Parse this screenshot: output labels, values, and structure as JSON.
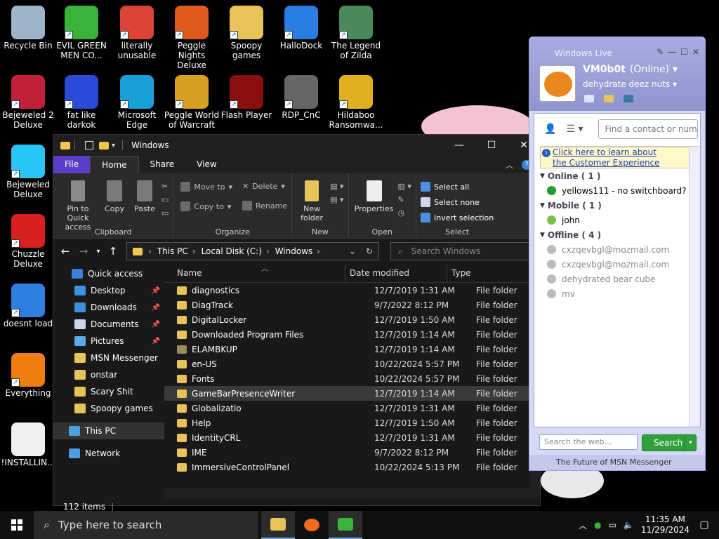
{
  "desktop": {
    "icons": [
      {
        "label": "Recycle Bin",
        "icon": "recycle-bin-icon",
        "color": "#9fb4c8"
      },
      {
        "label": "EVIL GREEN MEN CO...",
        "icon": "msn-buddies-icon",
        "color": "#3bb33b"
      },
      {
        "label": "literally unusable",
        "icon": "chrome-icon",
        "color": "#db4437"
      },
      {
        "label": "Peggle Nights Deluxe",
        "icon": "peggle-icon",
        "color": "#e05a1c"
      },
      {
        "label": "Spoopy games",
        "icon": "folder-icon",
        "color": "#e8c35a"
      },
      {
        "label": "HalloDock",
        "icon": "windows-shield-icon",
        "color": "#2a7de1"
      },
      {
        "label": "The Legend of Zilda",
        "icon": "game-character-icon",
        "color": "#4a8a5a"
      },
      {
        "label": "Bejeweled 2 Deluxe",
        "icon": "bejeweled-icon",
        "color": "#c0203a"
      },
      {
        "label": "fat like darkok",
        "icon": "mpl-icon",
        "color": "#2a4ad8"
      },
      {
        "label": "Microsoft Edge",
        "icon": "edge-icon",
        "color": "#1aa0d8"
      },
      {
        "label": "Peggle World of Warcraft ...",
        "icon": "peggle-wow-icon",
        "color": "#d8a020"
      },
      {
        "label": "Flash Player",
        "icon": "flash-icon",
        "color": "#8a1010"
      },
      {
        "label": "RDP_CnC",
        "icon": "rdp-icon",
        "color": "#666666"
      },
      {
        "label": "Hildaboo Ransomwa...",
        "icon": "yashma-shield-icon",
        "color": "#e0b020"
      },
      {
        "label": "Bejeweled Deluxe",
        "icon": "diamond-icon",
        "color": "#29c5f6"
      },
      {
        "label": "Chuzzle Deluxe",
        "icon": "chuzzle-icon",
        "color": "#d82020"
      },
      {
        "label": "doesnt load",
        "icon": "thunderbird-icon",
        "color": "#2f7fe0"
      },
      {
        "label": "Everything",
        "icon": "everything-search-icon",
        "color": "#ef7d10"
      },
      {
        "label": "!INSTALLIN...",
        "icon": "text-document-icon",
        "color": "#f0f0f0"
      }
    ]
  },
  "explorer": {
    "title": "Windows",
    "window_controls": {
      "minimize": "—",
      "maximize": "☐",
      "close": "✕"
    },
    "tabs": [
      {
        "label": "File"
      },
      {
        "label": "Home"
      },
      {
        "label": "Share"
      },
      {
        "label": "View"
      }
    ],
    "ribbon": {
      "clipboard": {
        "name": "Clipboard",
        "pin_label": "Pin to Quick access",
        "copy_label": "Copy",
        "paste_label": "Paste"
      },
      "organize": {
        "name": "Organize",
        "move_to": "Move to",
        "copy_to": "Copy to",
        "delete": "Delete",
        "rename": "Rename"
      },
      "new": {
        "name": "New",
        "new_folder": "New folder"
      },
      "open": {
        "name": "Open",
        "properties": "Properties"
      },
      "select": {
        "name": "Select",
        "select_all": "Select all",
        "select_none": "Select none",
        "invert": "Invert selection"
      }
    },
    "address": {
      "crumbs": [
        "This PC",
        "Local Disk (C:)",
        "Windows"
      ],
      "search_placeholder": "Search Windows"
    },
    "nav": [
      {
        "label": "Quick access",
        "icon": "star-icon",
        "color": "#3d7fd6"
      },
      {
        "label": "Desktop",
        "icon": "desktop-icon",
        "color": "#3d8fe0"
      },
      {
        "label": "Downloads",
        "icon": "download-icon",
        "color": "#3d8fe0"
      },
      {
        "label": "Documents",
        "icon": "documents-icon",
        "color": "#cfd8e8"
      },
      {
        "label": "Pictures",
        "icon": "pictures-icon",
        "color": "#5fa8e8"
      },
      {
        "label": "MSN Messenger",
        "icon": "folder-icon",
        "color": "#e8c35a"
      },
      {
        "label": "onstar",
        "icon": "folder-icon",
        "color": "#e8c35a"
      },
      {
        "label": "Scary Shit",
        "icon": "folder-icon",
        "color": "#e8c35a"
      },
      {
        "label": "Spoopy games",
        "icon": "folder-icon",
        "color": "#e8c35a"
      },
      {
        "label": "This PC",
        "icon": "computer-icon",
        "color": "#4aa0e0"
      },
      {
        "label": "Network",
        "icon": "network-icon",
        "color": "#4aa0e0"
      }
    ],
    "columns": {
      "name": "Name",
      "date": "Date modified",
      "type": "Type"
    },
    "files": [
      {
        "name": "diagnostics",
        "date": "12/7/2019 1:31 AM",
        "type": "File folder"
      },
      {
        "name": "DiagTrack",
        "date": "9/7/2022 8:12 PM",
        "type": "File folder"
      },
      {
        "name": "DigitalLocker",
        "date": "12/7/2019 1:50 AM",
        "type": "File folder"
      },
      {
        "name": "Downloaded Program Files",
        "date": "12/7/2019 1:14 AM",
        "type": "File folder"
      },
      {
        "name": "ELAMBKUP",
        "date": "12/7/2019 1:14 AM",
        "type": "File folder"
      },
      {
        "name": "en-US",
        "date": "10/22/2024 5:57 PM",
        "type": "File folder"
      },
      {
        "name": "Fonts",
        "date": "10/22/2024 5:57 PM",
        "type": "File folder"
      },
      {
        "name": "GameBarPresenceWriter",
        "date": "12/7/2019 1:14 AM",
        "type": "File folder"
      },
      {
        "name": "Globalizatio",
        "date": "12/7/2019 1:31 AM",
        "type": "File folder"
      },
      {
        "name": "Help",
        "date": "12/7/2019 1:50 AM",
        "type": "File folder"
      },
      {
        "name": "IdentityCRL",
        "date": "12/7/2019 1:31 AM",
        "type": "File folder"
      },
      {
        "name": "IME",
        "date": "9/7/2022 8:12 PM",
        "type": "File folder"
      },
      {
        "name": "ImmersiveControlPanel",
        "date": "10/22/2024 5:13 PM",
        "type": "File folder"
      }
    ],
    "status": "112 items"
  },
  "messenger": {
    "brand": "Windows Live",
    "display_name": "VM0b0t",
    "status": "(Online)",
    "personal_message": "dehydrate deez nuts",
    "find_placeholder": "Find a contact or number",
    "banner": "Click here to learn about the Customer Experience",
    "groups": [
      {
        "label": "Online ( 1 )",
        "contacts": [
          {
            "name": "yellows111 - no switchboard?",
            "color": "#2a9a2a"
          }
        ]
      },
      {
        "label": "Mobile ( 1 )",
        "contacts": [
          {
            "name": "john",
            "color": "#7ac04a"
          }
        ]
      },
      {
        "label": "Offline ( 4 )",
        "contacts": [
          {
            "name": "cxzqevbgl@mozmail.com",
            "color": "#bbbbbb"
          },
          {
            "name": "cxzqevbgl@mozmail.com",
            "color": "#bbbbbb"
          },
          {
            "name": "dehydrated bear cube",
            "color": "#bbbbbb"
          },
          {
            "name": "mv",
            "color": "#bbbbbb"
          }
        ]
      }
    ],
    "search_placeholder": "Search the web...",
    "search_button": "Search",
    "footer": "The Future of MSN Messenger"
  },
  "taskbar": {
    "search_placeholder": "Type here to search",
    "apps": [
      {
        "icon": "file-explorer-icon",
        "color": "#e8c35a",
        "active": true
      },
      {
        "icon": "firefox-icon",
        "color": "#ef6a1c",
        "active": false
      },
      {
        "icon": "msn-messenger-icon",
        "color": "#3bb33b",
        "active": true
      }
    ],
    "time": "11:35 AM",
    "date": "11/29/2024"
  }
}
